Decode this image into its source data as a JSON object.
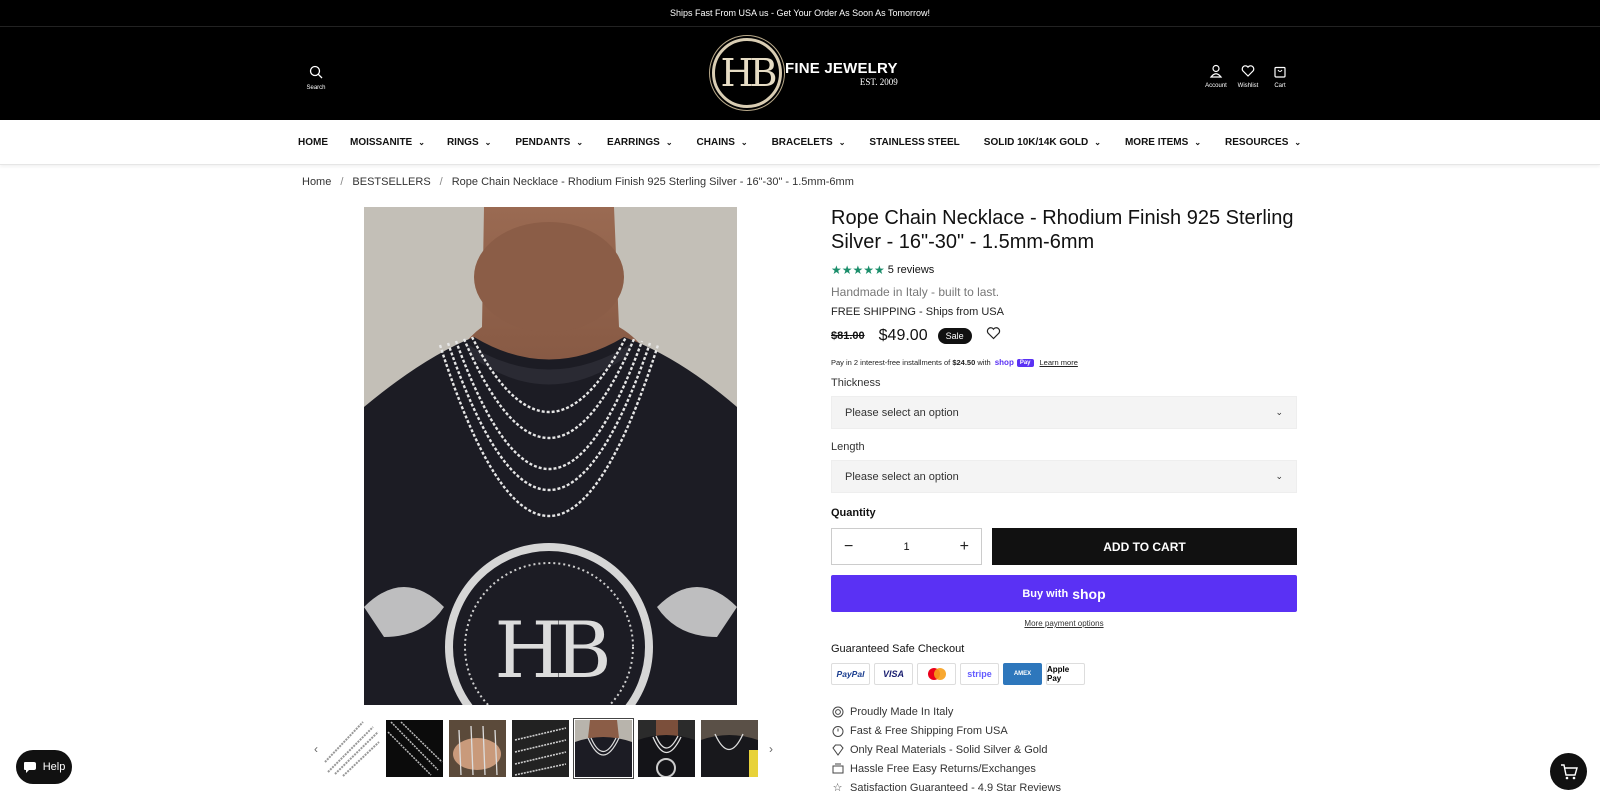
{
  "announcement": "Ships Fast From USA us - Get Your Order As Soon As Tomorrow!",
  "header": {
    "search_label": "Search",
    "logo_mark": "HB",
    "logo_title": "FINE JEWELRY",
    "logo_sub": "EST. 2009",
    "account_label": "Account",
    "wishlist_label": "Wishlist",
    "cart_label": "Cart"
  },
  "nav": [
    {
      "label": "HOME",
      "dropdown": false
    },
    {
      "label": "MOISSANITE",
      "dropdown": true
    },
    {
      "label": "RINGS",
      "dropdown": true
    },
    {
      "label": "PENDANTS",
      "dropdown": true
    },
    {
      "label": "EARRINGS",
      "dropdown": true
    },
    {
      "label": "CHAINS",
      "dropdown": true
    },
    {
      "label": "BRACELETS",
      "dropdown": true
    },
    {
      "label": "STAINLESS STEEL",
      "dropdown": false
    },
    {
      "label": "SOLID 10K/14K GOLD",
      "dropdown": true
    },
    {
      "label": "MORE ITEMS",
      "dropdown": true
    },
    {
      "label": "RESOURCES",
      "dropdown": true
    }
  ],
  "breadcrumb": [
    "Home",
    "BESTSELLERS",
    "Rope Chain Necklace - Rhodium Finish 925 Sterling Silver - 16\"-30\" - 1.5mm-6mm"
  ],
  "product": {
    "title": "Rope Chain Necklace - Rhodium Finish 925 Sterling Silver - 16\"-30\" - 1.5mm-6mm",
    "rating_stars": 5,
    "reviews": "5 reviews",
    "tagline": "Handmade in Italy - built to last.",
    "shipping": "FREE SHIPPING - Ships from USA",
    "old_price": "$81.00",
    "price": "$49.00",
    "sale_badge": "Sale",
    "installments_prefix": "Pay in 2 interest-free installments of",
    "installment_amount": "$24.50",
    "installments_with": "with",
    "shop_pay_mark": "Pay",
    "shop_word": "shop",
    "learn_more": "Learn more",
    "thickness_label": "Thickness",
    "thickness_value": "Please select an option",
    "length_label": "Length",
    "length_value": "Please select an option",
    "quantity_label": "Quantity",
    "quantity": "1",
    "add_to_cart": "ADD TO CART",
    "buy_with": "Buy with",
    "buy_shop": "shop",
    "more_payment": "More payment options",
    "secure_checkout": "Guaranteed Safe Checkout",
    "payment_methods": [
      "PayPal",
      "VISA",
      "Mastercard",
      "stripe",
      "AMEX",
      "Apple Pay"
    ],
    "features": [
      {
        "icon": "italy-badge-icon",
        "text": "Proudly Made In Italy"
      },
      {
        "icon": "stopwatch-icon",
        "text": "Fast & Free Shipping From USA"
      },
      {
        "icon": "diamond-icon",
        "text": "Only Real Materials - Solid Silver & Gold"
      },
      {
        "icon": "returns-icon",
        "text": "Hassle Free Easy Returns/Exchanges"
      },
      {
        "icon": "star-outline-icon",
        "text": "Satisfaction Guaranteed - 4.9 Star Reviews"
      }
    ]
  },
  "gallery": {
    "thumbnails": 7,
    "active_thumbnail": 5
  },
  "help_label": "Help",
  "colors": {
    "brand_black": "#000000",
    "star_green": "#1b8e6b",
    "shop_pay_purple": "#5a31f4"
  }
}
